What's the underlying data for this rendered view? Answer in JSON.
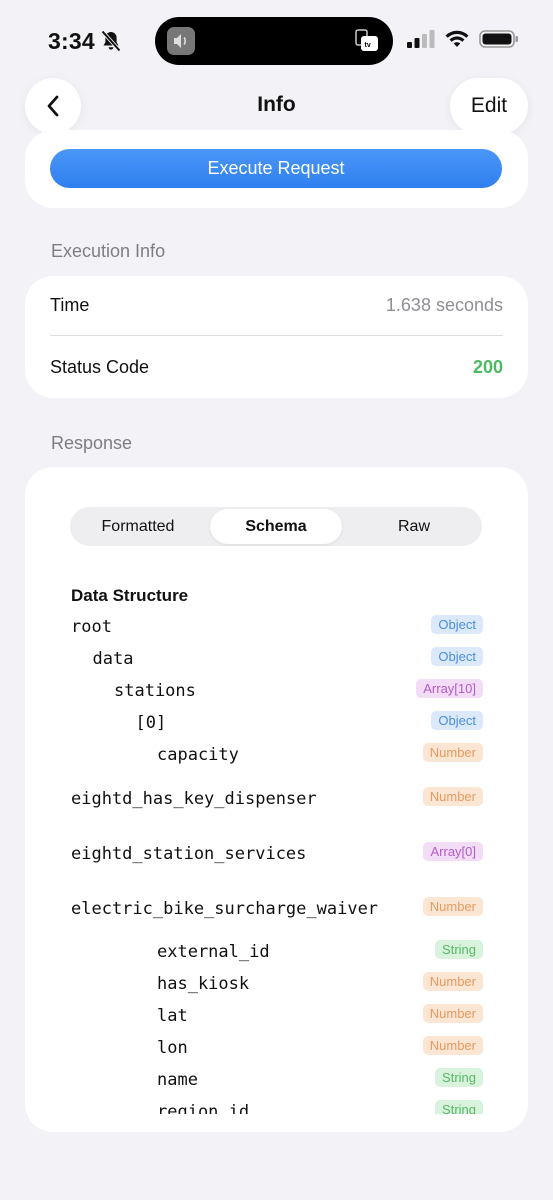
{
  "status_bar": {
    "time": "3:34"
  },
  "nav": {
    "title": "Info",
    "edit_label": "Edit"
  },
  "execute": {
    "button_label": "Execute Request"
  },
  "execution_info": {
    "section_label": "Execution Info",
    "time_label": "Time",
    "time_value": "1.638 seconds",
    "status_label": "Status Code",
    "status_value": "200"
  },
  "response": {
    "section_label": "Response",
    "tabs": [
      "Formatted",
      "Schema",
      "Raw"
    ],
    "active_tab": "Schema",
    "schema_title": "Data Structure",
    "tree": [
      {
        "name": "root",
        "type": "Object",
        "depth": 0
      },
      {
        "name": "data",
        "type": "Object",
        "depth": 1
      },
      {
        "name": "stations",
        "type": "Array[10]",
        "depth": 2
      },
      {
        "name": "[0]",
        "type": "Object",
        "depth": 3
      },
      {
        "name": "capacity",
        "type": "Number",
        "depth": 4
      },
      {
        "name": "eightd_has_key_dispenser",
        "type": "Number",
        "depth": 0
      },
      {
        "name": "eightd_station_services",
        "type": "Array[0]",
        "depth": 0
      },
      {
        "name": "electric_bike_surcharge_waiver",
        "type": "Number",
        "depth": 0
      },
      {
        "name": "external_id",
        "type": "String",
        "depth": 4
      },
      {
        "name": "has_kiosk",
        "type": "Number",
        "depth": 4
      },
      {
        "name": "lat",
        "type": "Number",
        "depth": 4
      },
      {
        "name": "lon",
        "type": "Number",
        "depth": 4
      },
      {
        "name": "name",
        "type": "String",
        "depth": 4
      },
      {
        "name": "region_id",
        "type": "String",
        "depth": 4
      }
    ]
  },
  "colors": {
    "accent": "#2f7ff0",
    "success": "#4cbb62",
    "object": "#4a8fe0",
    "array": "#b45ccb",
    "number": "#e89a5e",
    "string": "#55b967"
  }
}
